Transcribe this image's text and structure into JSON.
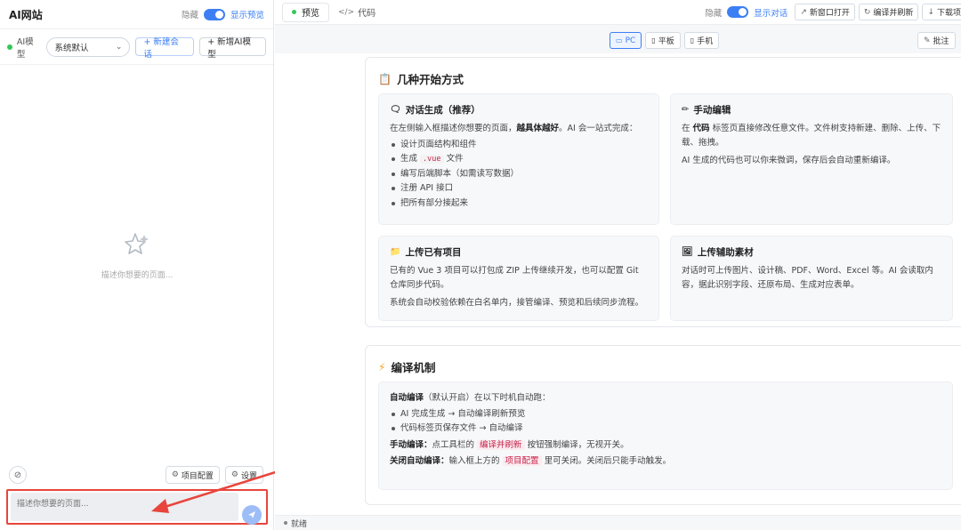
{
  "left": {
    "title": "AI网站",
    "hide_label": "隐藏",
    "show_preview": "显示预览",
    "model_label": "AI模型",
    "model_value": "系统默认",
    "new_chat": "+ 新建会话",
    "new_model": "+ 新增AI模型",
    "empty_text": "描述你想要的页面...",
    "project_config": "项目配置",
    "settings": "设置",
    "input_placeholder": "描述你想要的页面..."
  },
  "toolbar": {
    "tab_preview": "预览",
    "tab_code": "代码",
    "hide_label": "隐藏",
    "show_chat": "显示对话",
    "open_new_window": "新窗口打开",
    "compile_refresh": "编译并刷新",
    "download": "下载项"
  },
  "devices": {
    "pc": "PC",
    "tablet": "平板",
    "phone": "手机",
    "annotate": "批注"
  },
  "content": {
    "section1_title": "几种开始方式",
    "card_chat": {
      "title": "对话生成（推荐）",
      "desc_pre": "在左侧输入框描述你想要的页面，",
      "desc_bold": "越具体越好",
      "desc_post": "。AI 会一站式完成：",
      "items": [
        "设计页面结构和组件",
        "生成",
        "文件",
        "编写后端脚本（如需读写数据）",
        "注册 API 接口",
        "把所有部分接起来"
      ],
      "vue_code": ".vue"
    },
    "card_manual": {
      "title": "手动编辑",
      "line1_pre": "在 ",
      "line1_bold": "代码",
      "line1_post": " 标签页直接修改任意文件。文件树支持新建、删除、上传、下载、拖拽。",
      "line2": "AI 生成的代码也可以你来微调，保存后会自动重新编译。"
    },
    "card_upload": {
      "title": "上传已有项目",
      "p1": "已有的 Vue 3 项目可以打包成 ZIP 上传继续开发，也可以配置 Git 仓库同步代码。",
      "p2": "系统会自动校验依赖在白名单内，接管编译、预览和后续同步流程。"
    },
    "card_assets": {
      "title": "上传辅助素材",
      "p1": "对话时可上传图片、设计稿、PDF、Word、Excel 等。AI 会读取内容，据此识别字段、还原布局、生成对应表单。"
    },
    "section2_title": "编译机制",
    "compile": {
      "auto_bold": "自动编译",
      "auto_rest": "（默认开启）在以下时机自动跑：",
      "items": [
        "AI 完成生成 → 自动编译刷新预览",
        "代码标签页保存文件 → 自动编译"
      ],
      "manual_bold": "手动编译：",
      "manual_pre": "点工具栏的 ",
      "manual_tag": "编译并刷新",
      "manual_post": " 按钮强制编译，无视开关。",
      "close_bold": "关闭自动编译：",
      "close_pre": "输入框上方的 ",
      "close_tag": "项目配置",
      "close_post": " 里可关闭。关闭后只能手动触发。"
    }
  },
  "status": {
    "text": "就绪"
  },
  "colors": {
    "accent": "#3c7ff4",
    "highlight": "#e8453c",
    "online": "#34c759"
  }
}
